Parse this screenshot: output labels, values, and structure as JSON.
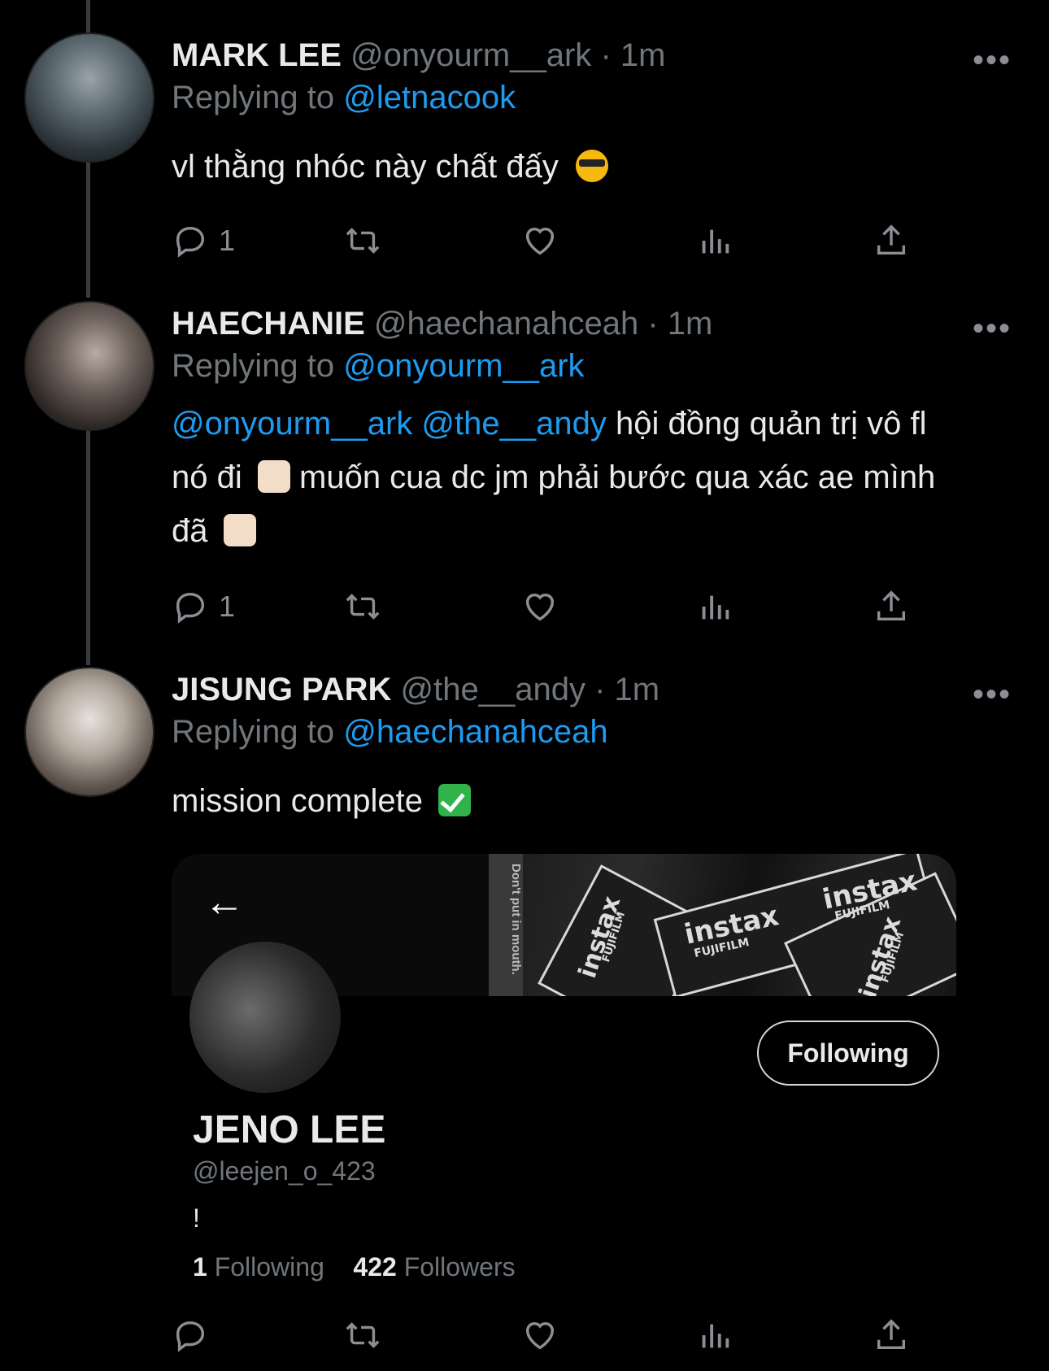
{
  "tweets": [
    {
      "name": "MARK LEE",
      "handle": "@onyourm__ark",
      "time": "· 1m",
      "replying_prefix": "Replying to",
      "replying_to": "@letnacook",
      "text": "vl thằng nhóc này chất đấy",
      "reply_count": "1"
    },
    {
      "name": "HAECHANIE",
      "handle": "@haechanahceah",
      "time": "· 1m",
      "replying_prefix": "Replying to",
      "replying_to": "@onyourm__ark",
      "mention1": "@onyourm__ark",
      "mention2": "@the__andy",
      "text_line1": " hội đồng quản trị vô fl",
      "text_line2a": "nó đi",
      "text_line2b": " muốn cua dc jm phải bước qua xác ae mình",
      "text_line3": "đã",
      "reply_count": "1"
    },
    {
      "name": "JISUNG PARK",
      "handle": "@the__andy",
      "time": "· 1m",
      "replying_prefix": "Replying to",
      "replying_to": "@haechanahceah",
      "text": "mission complete"
    }
  ],
  "more_label": "•••",
  "profile_card": {
    "banner_strip": "Don't put in mouth.",
    "banner_labels": [
      "instax",
      "FUJIFILM",
      "instax",
      "FUJIFILM",
      "instax",
      "FUJIFILM",
      "instax",
      "FUJIFILM"
    ],
    "back_icon": "←",
    "follow_button": "Following",
    "name": "JENO LEE",
    "handle": "@leejen_o_423",
    "bio": "!",
    "following_count": "1",
    "following_label": "Following",
    "followers_count": "422",
    "followers_label": "Followers"
  },
  "icons": [
    "reply-icon",
    "retweet-icon",
    "like-icon",
    "views-icon",
    "share-icon",
    "more-icon",
    "back-arrow-icon"
  ],
  "colors": {
    "accent": "#1d9bf0",
    "muted": "#71767b",
    "text": "#e7e9ea",
    "background": "#000000"
  }
}
